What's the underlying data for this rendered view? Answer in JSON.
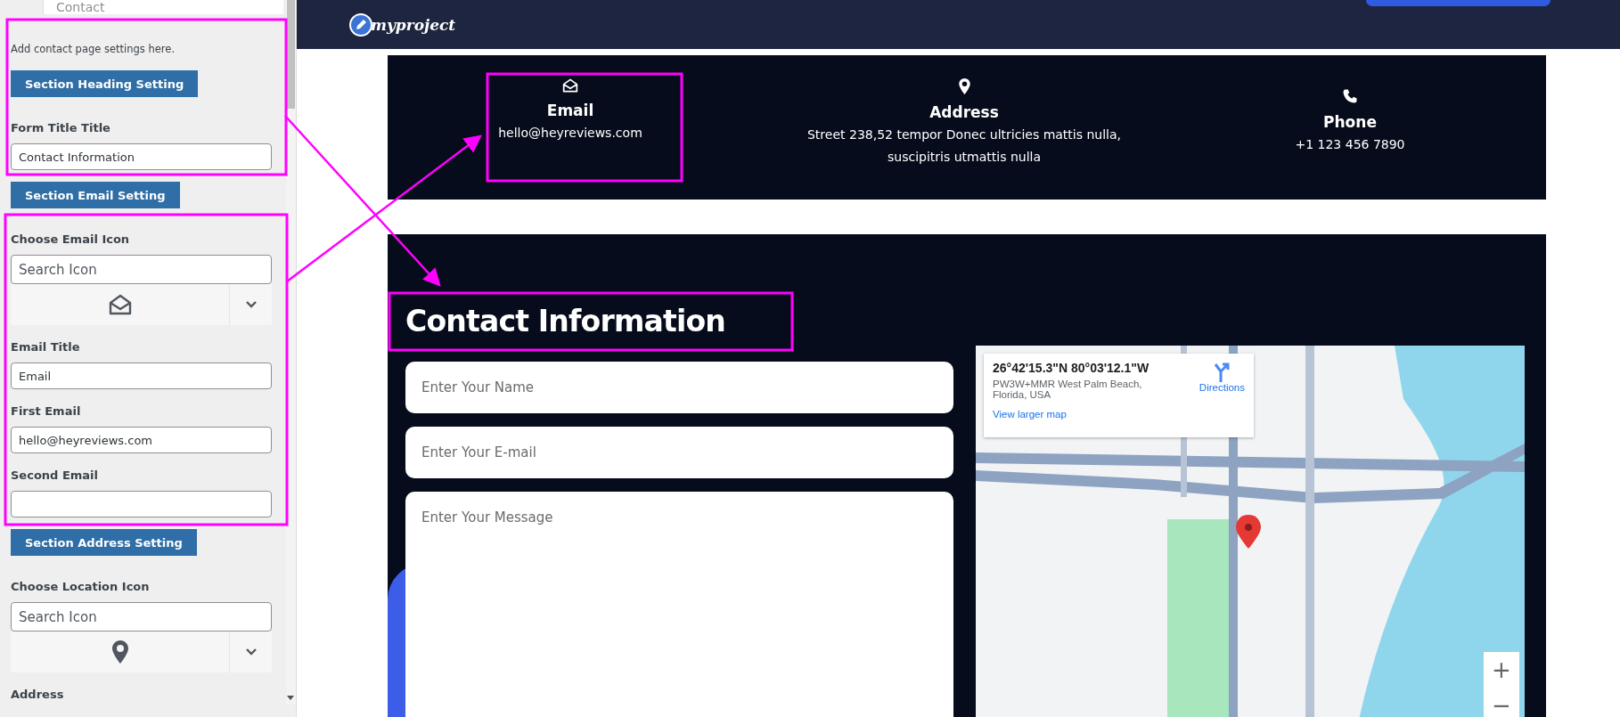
{
  "sidebar": {
    "menu_item": "Contact",
    "intro": "Add contact page settings here.",
    "items": [
      {
        "kind": "button",
        "text": "Section Heading Setting"
      },
      {
        "kind": "label",
        "text": "Form Title Title"
      },
      {
        "kind": "field",
        "value": "Contact Information"
      },
      {
        "kind": "button",
        "text": "Section Email Setting"
      },
      {
        "kind": "label",
        "text": "Choose Email Icon"
      },
      {
        "kind": "field",
        "placeholder": "Search Icon"
      },
      {
        "kind": "picker"
      },
      {
        "kind": "label",
        "text": "Email Title"
      },
      {
        "kind": "field",
        "value": "Email"
      },
      {
        "kind": "label",
        "text": "First Email"
      },
      {
        "kind": "field",
        "value": "hello@heyreviews.com"
      },
      {
        "kind": "label",
        "text": "Second Email"
      },
      {
        "kind": "field"
      },
      {
        "kind": "button",
        "text": "Section Address Setting"
      },
      {
        "kind": "label",
        "text": "Choose Location Icon"
      },
      {
        "kind": "field",
        "placeholder": "Search Icon"
      },
      {
        "kind": "picker"
      },
      {
        "kind": "label",
        "text": "Address"
      }
    ]
  },
  "header": {
    "logo": "myproject"
  },
  "info_bar": [
    {
      "title": "Email",
      "text": "hello@heyreviews.com"
    },
    {
      "title": "Address",
      "text": "Street 238,52 tempor Donec ultricies mattis nulla, suscipitris utmattis nulla"
    },
    {
      "title": "Phone",
      "text": "+1 123 456 7890"
    }
  ],
  "contact": {
    "heading": "Contact Information",
    "fields": [
      {
        "kind": "input",
        "placeholder": "Enter Your Name"
      },
      {
        "kind": "input",
        "placeholder": "Enter Your E-mail"
      },
      {
        "kind": "textarea",
        "placeholder": "Enter Your Message"
      }
    ],
    "map": {
      "coordinates": "26°42'15.3\"N 80°03'12.1\"W",
      "address": "PW3W+MMR West Palm Beach, Florida, USA",
      "directions": "Directions",
      "larger_map_link": "View larger map",
      "zoom_in": "+",
      "zoom_out": "−"
    }
  }
}
